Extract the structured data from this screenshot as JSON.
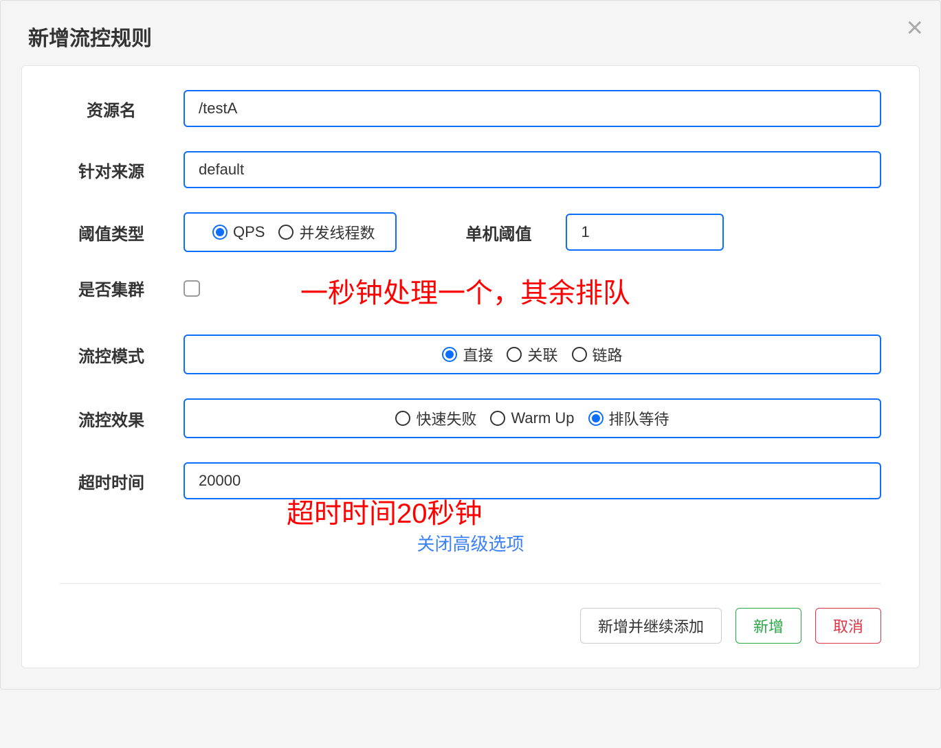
{
  "modal": {
    "title": "新增流控规则"
  },
  "form": {
    "resource_label": "资源名",
    "resource_value": "/testA",
    "source_label": "针对来源",
    "source_value": "default",
    "threshold_type_label": "阈值类型",
    "threshold_type_options": {
      "qps": "QPS",
      "thread": "并发线程数"
    },
    "single_threshold_label": "单机阈值",
    "single_threshold_value": "1",
    "cluster_label": "是否集群",
    "flow_mode_label": "流控模式",
    "flow_mode_options": {
      "direct": "直接",
      "relation": "关联",
      "chain": "链路"
    },
    "flow_effect_label": "流控效果",
    "flow_effect_options": {
      "fast_fail": "快速失败",
      "warm_up": "Warm Up",
      "queue": "排队等待"
    },
    "timeout_label": "超时时间",
    "timeout_value": "20000",
    "close_advanced": "关闭高级选项"
  },
  "annotations": {
    "line1": "一秒钟处理一个，其余排队",
    "line2": "超时时间20秒钟"
  },
  "buttons": {
    "add_continue": "新增并继续添加",
    "add": "新增",
    "cancel": "取消"
  }
}
